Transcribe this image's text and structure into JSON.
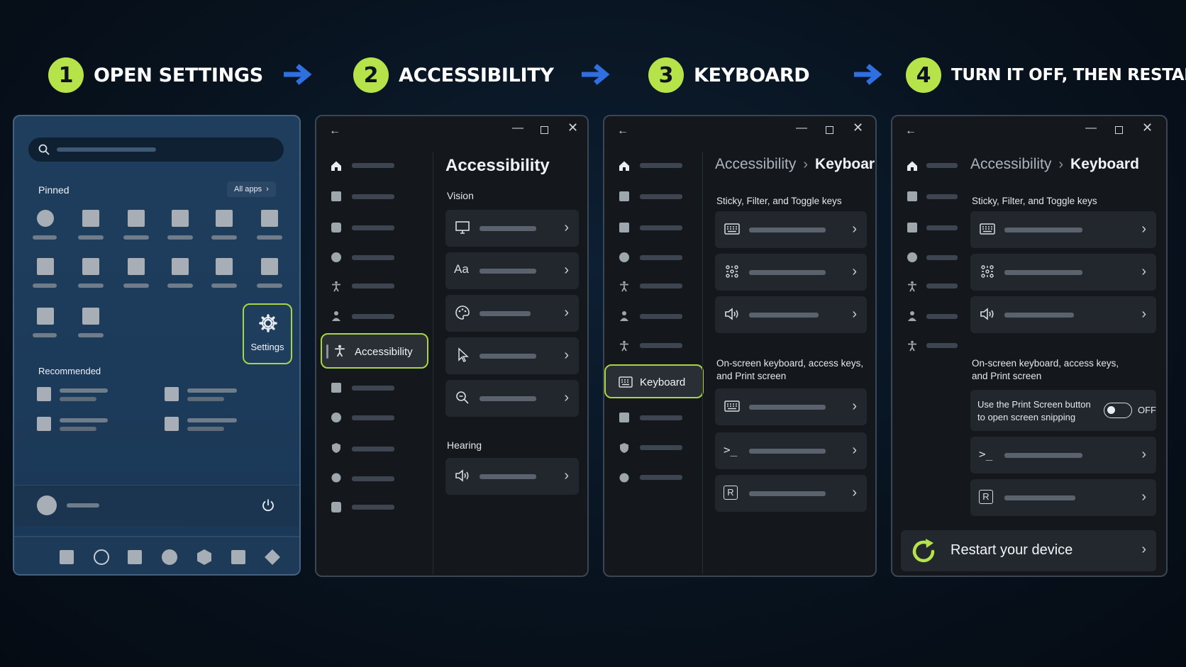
{
  "steps": [
    {
      "num": "1",
      "label": "OPEN SETTINGS"
    },
    {
      "num": "2",
      "label": "ACCESSIBILITY"
    },
    {
      "num": "3",
      "label": "KEYBOARD"
    },
    {
      "num": "4",
      "label": "TURN IT OFF, THEN RESTART"
    }
  ],
  "start": {
    "pinned_label": "Pinned",
    "all_apps_label": "All apps",
    "settings_label": "Settings",
    "recommended_label": "Recommended"
  },
  "accessibility_window": {
    "title": "Accessibility",
    "selected_nav": "Accessibility",
    "vision_header": "Vision",
    "hearing_header": "Hearing",
    "text_size_glyph": "Aa"
  },
  "keyboard_window": {
    "crumb_parent": "Accessibility",
    "crumb_current": "Keyboard",
    "selected_nav": "Keyboard",
    "section1": "Sticky, Filter, and Toggle keys",
    "section2_line1": "On-screen keyboard, access keys,",
    "section2_line2": "and Print screen"
  },
  "final_window": {
    "crumb_parent": "Accessibility",
    "crumb_current": "Keyboard",
    "section1": "Sticky, Filter, and Toggle keys",
    "section2_line1": "On-screen keyboard, access keys,",
    "section2_line2": "and Print screen",
    "print_screen_line1": "Use the Print Screen button",
    "print_screen_line2": "to open screen snipping",
    "toggle_state": "OFF",
    "restart_label": "Restart your device"
  },
  "colors": {
    "accent_green": "#b7e34a",
    "arrow_blue": "#2f6fe0",
    "panel_bg": "#14181d",
    "start_bg": "#1f3e5e"
  },
  "icons": {
    "terminal_glyph": ">_",
    "r_key_glyph": "R"
  }
}
